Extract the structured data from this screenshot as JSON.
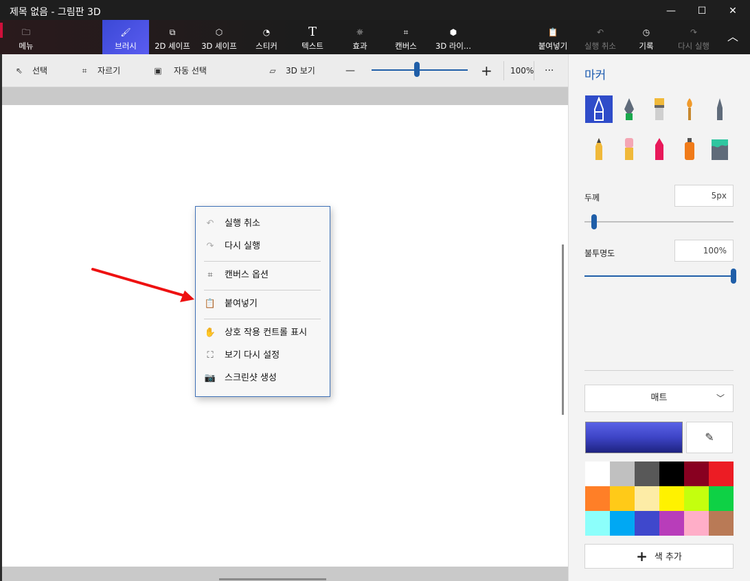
{
  "window": {
    "title": "제목 없음 - 그림판 3D",
    "minimize_glyph": "—",
    "maximize_glyph": "☐",
    "close_glyph": "✕"
  },
  "ribbon": {
    "tabs": [
      {
        "label": "메뉴",
        "icon": "folder-icon",
        "glyph": "🗀"
      },
      {
        "label": "브러시",
        "icon": "brush-icon",
        "glyph": "🖌",
        "active": true
      },
      {
        "label": "2D 셰이프",
        "icon": "2d-shapes-icon",
        "glyph": "⧉"
      },
      {
        "label": "3D 셰이프",
        "icon": "3d-shapes-icon",
        "glyph": "⬡"
      },
      {
        "label": "스티커",
        "icon": "sticker-icon",
        "glyph": "◔"
      },
      {
        "label": "텍스트",
        "icon": "text-icon",
        "glyph": "T"
      },
      {
        "label": "효과",
        "icon": "effects-icon",
        "glyph": "☼"
      },
      {
        "label": "캔버스",
        "icon": "canvas-icon",
        "glyph": "⌗"
      },
      {
        "label": "3D 라이...",
        "icon": "3d-library-icon",
        "glyph": "⬢"
      },
      {
        "label": "붙여넣기",
        "icon": "paste-icon",
        "glyph": "📋"
      },
      {
        "label": "실행 취소",
        "icon": "undo-icon",
        "glyph": "↶",
        "disabled": true
      },
      {
        "label": "기록",
        "icon": "history-icon",
        "glyph": "◷"
      },
      {
        "label": "다시 실행",
        "icon": "redo-icon",
        "glyph": "↷",
        "disabled": true
      }
    ],
    "collapse_glyph": "︿"
  },
  "toolbar": {
    "select_label": "선택",
    "crop_label": "자르기",
    "magic_select_label": "자동 선택",
    "view3d_label": "3D 보기",
    "zoom_out_glyph": "—",
    "zoom_in_glyph": "+",
    "zoom_value": "100%",
    "more_glyph": "···",
    "zoom_level": 0.47
  },
  "context_menu": {
    "undo": "실행 취소",
    "redo": "다시 실행",
    "canvas_options": "캔버스 옵션",
    "paste": "붙여넣기",
    "show_interaction": "상호 작용 컨트롤 표시",
    "reset_view": "보기 다시 설정",
    "screenshot": "스크린샷 생성"
  },
  "panel": {
    "title": "마커",
    "thickness_label": "두께",
    "thickness_value": "5px",
    "thickness_level": 0.01,
    "opacity_label": "불투명도",
    "opacity_value": "100%",
    "opacity_level": 1.0,
    "finish": "매트",
    "add_color": "색 추가",
    "current_color": "#3d44c6",
    "palette": [
      "#ffffff",
      "#c0c0c0",
      "#585858",
      "#000000",
      "#880020",
      "#ec1c24",
      "#ff7f27",
      "#ffca18",
      "#fdeca6",
      "#fff200",
      "#c4ff0e",
      "#0ed145",
      "#8cfffb",
      "#00a8f3",
      "#3f48cc",
      "#b83dba",
      "#ffaec8",
      "#b97a56"
    ]
  }
}
